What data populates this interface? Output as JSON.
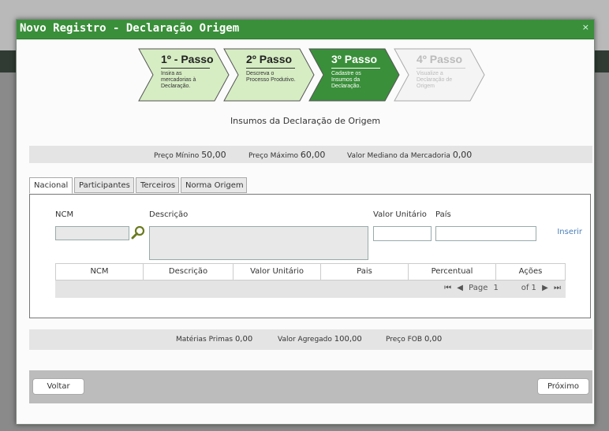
{
  "modal": {
    "title": "Novo Registro - Declaração Origem",
    "close": "×"
  },
  "steps": [
    {
      "title": "1º - Passo",
      "desc": "Insira as mercadorias à Declaração.",
      "state": "done",
      "fill": "#d6edc4"
    },
    {
      "title": "2º Passo",
      "desc": "Descreva o Processo Produtivo.",
      "state": "done",
      "fill": "#d6edc4"
    },
    {
      "title": "3º Passo",
      "desc": "Cadastre os Insumos da Declaração.",
      "state": "active",
      "fill": "#3a8f3a"
    },
    {
      "title": "4º Passo",
      "desc": "Visualize a Declaração de Origem",
      "state": "disabled",
      "fill": "#f4f4f4"
    }
  ],
  "subtitle": "Insumos da Declaração de Origem",
  "prices": {
    "min_label": "Preço Mínino",
    "min_value": "50,00",
    "max_label": "Preço Máximo",
    "max_value": "60,00",
    "median_label": "Valor Mediano da Mercadoria",
    "median_value": "0,00"
  },
  "tabs": [
    "Nacional",
    "Participantes",
    "Terceiros",
    "Norma Origem"
  ],
  "form": {
    "ncm_label": "NCM",
    "desc_label": "Descrição",
    "valor_label": "Valor Unitário",
    "pais_label": "País",
    "insert_label": "Inserir"
  },
  "grid": {
    "columns": [
      "NCM",
      "Descrição",
      "Valor Unitário",
      "Pais",
      "Percentual",
      "Ações"
    ],
    "pager": {
      "first": "⏮",
      "prev": "◀",
      "page_label": "Page",
      "page": "1",
      "of_label": "of 1",
      "next": "▶",
      "last": "⏭"
    }
  },
  "totals": {
    "mp_label": "Matérias Primas",
    "mp_value": "0,00",
    "va_label": "Valor Agregado",
    "va_value": "100,00",
    "fob_label": "Preço FOB",
    "fob_value": "0,00"
  },
  "buttons": {
    "back": "Voltar",
    "next": "Próximo"
  },
  "colors": {
    "header": "#3a8f3a",
    "step_done": "#d6edc4",
    "step_active": "#3a8f3a",
    "link": "#4a7fb8"
  }
}
